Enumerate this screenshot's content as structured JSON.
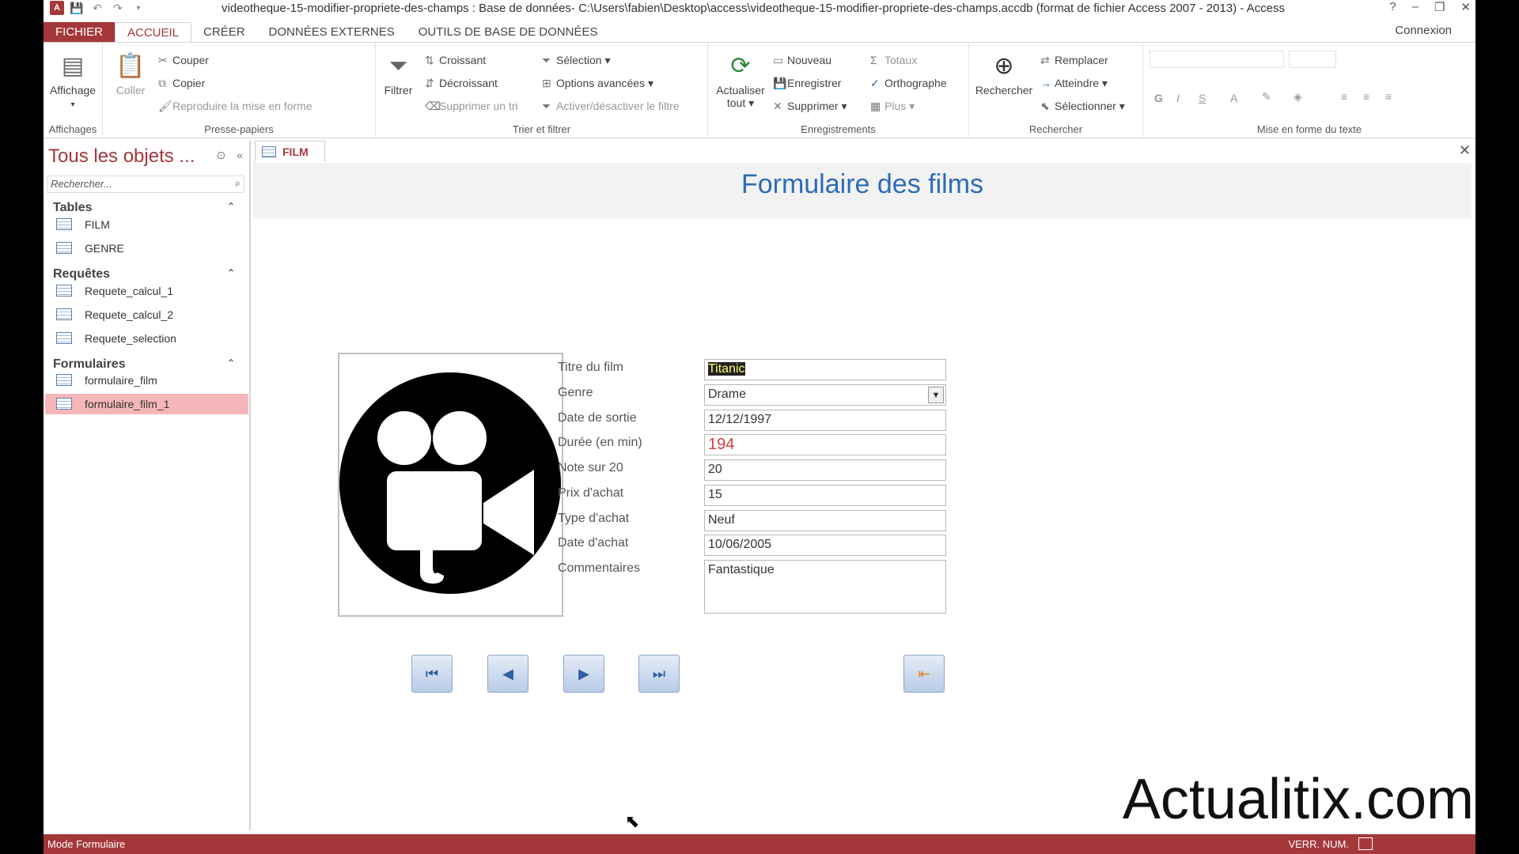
{
  "window": {
    "title": "videotheque-15-modifier-propriete-des-champs : Base de données- C:\\Users\\fabien\\Desktop\\access\\videotheque-15-modifier-propriete-des-champs.accdb (format de fichier Access 2007 - 2013) - Access",
    "help": "?",
    "minimize": "–",
    "restore": "❐",
    "close": "✕"
  },
  "tabs": [
    "FICHIER",
    "ACCUEIL",
    "CRÉER",
    "DONNÉES EXTERNES",
    "OUTILS DE BASE DE DONNÉES"
  ],
  "connexion": "Connexion",
  "ribbon": {
    "affichages": {
      "label": "Affichages",
      "btn": "Affichage"
    },
    "presse": {
      "label": "Presse-papiers",
      "coller": "Coller",
      "couper": "Couper",
      "copier": "Copier",
      "reproduire": "Reproduire la mise en forme"
    },
    "trier": {
      "label": "Trier et filtrer",
      "filtrer": "Filtrer",
      "croissant": "Croissant",
      "decroissant": "Décroissant",
      "supprimer_tri": "Supprimer un tri",
      "selection": "Sélection",
      "options": "Options avancées",
      "activer": "Activer/désactiver le filtre"
    },
    "enreg": {
      "label": "Enregistrements",
      "actualiser": "Actualiser",
      "tout": "tout",
      "nouveau": "Nouveau",
      "enregistrer": "Enregistrer",
      "supprimer": "Supprimer",
      "totaux": "Totaux",
      "orthographe": "Orthographe",
      "plus": "Plus"
    },
    "rechercher": {
      "label": "Rechercher",
      "btn": "Rechercher",
      "remplacer": "Remplacer",
      "atteindre": "Atteindre",
      "selectionner": "Sélectionner"
    },
    "mise": {
      "label": "Mise en forme du texte",
      "bold": "G",
      "italic": "I",
      "underline": "S",
      "font_color": "A"
    }
  },
  "nav": {
    "title": "Tous les objets ...",
    "search_placeholder": "Rechercher...",
    "sections": [
      {
        "label": "Tables",
        "items": [
          "FILM",
          "GENRE"
        ]
      },
      {
        "label": "Requêtes",
        "items": [
          "Requete_calcul_1",
          "Requete_calcul_2",
          "Requete_selection"
        ]
      },
      {
        "label": "Formulaires",
        "items": [
          "formulaire_film",
          "formulaire_film_1"
        ]
      }
    ]
  },
  "doc": {
    "tab": "FILM",
    "form_title": "Formulaire des films",
    "fields": [
      {
        "label": "Titre du film",
        "value": "Titanic"
      },
      {
        "label": "Genre",
        "value": "Drame"
      },
      {
        "label": "Date de sortie",
        "value": "12/12/1997"
      },
      {
        "label": "Durée (en min)",
        "value": "194"
      },
      {
        "label": "Note sur 20",
        "value": "20"
      },
      {
        "label": "Prix d'achat",
        "value": "15"
      },
      {
        "label": "Type d'achat",
        "value": "Neuf"
      },
      {
        "label": "Date d'achat",
        "value": "10/06/2005"
      },
      {
        "label": "Commentaires",
        "value": "Fantastique"
      }
    ]
  },
  "watermark": "Actualitix.com",
  "status": {
    "mode": "Mode Formulaire",
    "verr": "VERR. NUM."
  }
}
